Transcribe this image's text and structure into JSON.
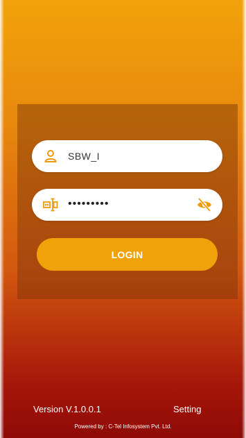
{
  "login_form": {
    "username_value": "SBW_I",
    "password_value": "•••••••••",
    "login_label": "LOGIN"
  },
  "footer": {
    "version": "Version V.1.0.0.1",
    "setting": "Setting",
    "powered_by": "Powered by : C-Tel Infosystem Pvt. Ltd."
  },
  "icons": {
    "user": "user-icon",
    "password": "password-icon",
    "visibility": "eye-off-icon"
  },
  "colors": {
    "accent": "#F0A20A",
    "background_top": "#F2A20A",
    "background_bottom": "#8E0A06"
  }
}
